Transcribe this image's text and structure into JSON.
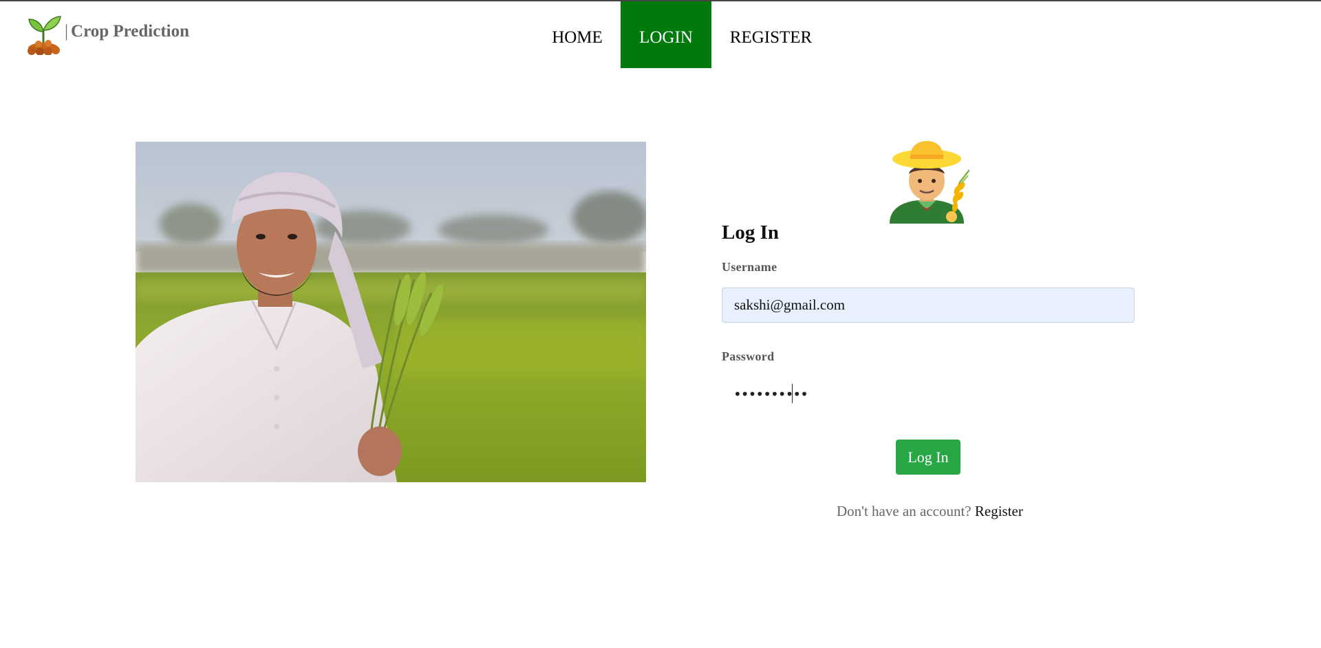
{
  "brand": {
    "separator": "|",
    "name": "Crop Prediction",
    "logo_icon": "sprout-logo-icon"
  },
  "nav": {
    "items": [
      {
        "label": "HOME",
        "active": false
      },
      {
        "label": "LOGIN",
        "active": true
      },
      {
        "label": "REGISTER",
        "active": false
      }
    ],
    "active_color": "#007a0d"
  },
  "hero": {
    "image": "farmer-holding-wheat-photo"
  },
  "form": {
    "avatar_icon": "farmer-emoji-icon",
    "title": "Log In",
    "username_label": "Username",
    "username_value": "sakshi@gmail.com",
    "password_label": "Password",
    "password_mask": "••••••••••",
    "submit_label": "Log In",
    "submit_color": "#28a745",
    "signup_prompt": "Don't have an account?",
    "signup_link": "Register"
  }
}
